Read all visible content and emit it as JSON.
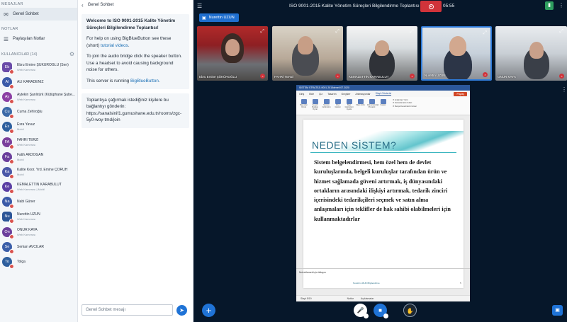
{
  "sidebar": {
    "messages_title": "MESAJLAR",
    "public_chat": "Genel Sohbet",
    "notes_title": "NOTLAR",
    "shared_notes": "Paylaşılan Notlar",
    "users_title": "KULLANICILAR (14)",
    "users": [
      {
        "initials": "Eb",
        "name": "Ebru Emine ŞÜKÜROĞLU (Sen)",
        "sub": "Web Kamerası",
        "color": "#6a4ba8"
      },
      {
        "initials": "Al",
        "name": "ALİ KARADENİZ",
        "sub": "",
        "color": "#3a5aa8"
      },
      {
        "initials": "Ay",
        "name": "Aytekin Şanlıtürk (Kütüphane Şube...",
        "sub": "Web Kamerası",
        "color": "#8b3fa3"
      },
      {
        "initials": "Cu",
        "name": "Cuma Zehiroğlu",
        "sub": "",
        "color": "#3b6aa8"
      },
      {
        "initials": "Es",
        "name": "Esra Yavuz",
        "sub": "Mobil",
        "color": "#2e5f9e"
      },
      {
        "initials": "FA",
        "name": "FAHRİ TERZİ",
        "sub": "Web Kamerası",
        "color": "#7a3f9c"
      },
      {
        "initials": "Fa",
        "name": "Fatih AKDOĞAN",
        "sub": "Mobil",
        "color": "#6b3f9c"
      },
      {
        "initials": "Ka",
        "name": "Kalite Koor. Yrd. Emine ÇORUH",
        "sub": "Mobil",
        "color": "#4a58a8"
      },
      {
        "initials": "Ke",
        "name": "KEMALETTİN KARABULUT",
        "sub": "Web Kamerası | Mobil",
        "color": "#5b3fa3"
      },
      {
        "initials": "Na",
        "name": "Nabi Güner",
        "sub": "",
        "color": "#3a5aa8"
      },
      {
        "initials": "Nu",
        "name": "Nurettin UZUN",
        "sub": "Web Kamerası",
        "color": "#2c5597"
      },
      {
        "initials": "On",
        "name": "ONUR KAYA",
        "sub": "Web Kamerası",
        "color": "#6b3f9c"
      },
      {
        "initials": "Se",
        "name": "Serkan AVCILAR",
        "sub": "",
        "color": "#3b5ea8"
      },
      {
        "initials": "To",
        "name": "Tolga",
        "sub": "",
        "color": "#2e5f9e"
      }
    ]
  },
  "chat": {
    "header": "Genel Sohbet",
    "welcome_prefix": "Welcome to ",
    "welcome_bold": "ISO 9001-2015 Kalite Yönetim Süreçleri Bilgilendirme Toplantısı!",
    "help_prefix": "For help on using BigBlueButton see these (short) ",
    "help_link": "tutorial videos",
    "help_suffix": ".",
    "audio_text": "To join the audio bridge click the speaker button. Use a headset to avoid causing background noise for others.",
    "server_prefix": "This server is running ",
    "server_link": "BigBlueButton",
    "server_suffix": ".",
    "invite_text": "Toplantıya çağırmak istediğiniz kişilere bu bağlantıyı gönderin: https://sanalsinif1.gumushane.edu.tr/rooms/zgc-5y0-woy-tmd/join",
    "input_placeholder": "Genel Sohbet mesajı"
  },
  "main": {
    "title": "ISO 9001-2015 Kalite Yönetim Süreçleri Bilgilendirme Toplantısı",
    "timer": "05:55",
    "presenter": "Nurettin UZUN",
    "videos": [
      {
        "name": "Ebru Emine ŞÜKÜROĞLU"
      },
      {
        "name": "FAHRİ TERZİ"
      },
      {
        "name": "KEMALETTİN KARABULUT"
      },
      {
        "name": "Nurettin UZUN"
      },
      {
        "name": "ONUR KAYA"
      }
    ]
  },
  "presentation": {
    "window_title": "SİSTEM STRATEJİ-9001 2015deneli 07.2020",
    "tabs": [
      "Giriş",
      "Ekle",
      "Çiz",
      "Tasarım",
      "Geçişler",
      "Animasyonlar",
      "Slayt Gösterisi"
    ],
    "share": "Paylaş",
    "ribbon": [
      "Başından Oynat",
      "Geçerli Slayttan Oynat",
      "Sunucu Görünümü",
      "Özel Gösteri",
      "Slayt Gösterisini Ayarla",
      "Slaytı Gizle",
      "Zamanlamaları Prova Et",
      "Kaydet"
    ],
    "checks": [
      "Anlatımları Yürüt",
      "Zamanlamaları Kullan",
      "Medya Denetimlerini Göster"
    ],
    "slide_title": "NEDEN SİSTEM?",
    "slide_body": "Sistem belgelendirmesi, hem özel hem de devlet kuruluşlarında, belgeli kuruluşlar tarafından ürün ve hizmet sağlamada güveni artırmak, iş dünyasındaki ortakların arasındaki ilişkiyi artırmak, tedarik zinciri içerisindeki tedarikçileri seçmek ve satın alma anlaşmaları için teklifler de hak sahibi olabilmeleri için kullanmaktadırlar",
    "slide_footer": "Nurettin UZUN Bilgilendirme",
    "slide_number": "5",
    "notes_placeholder": "Not eklemek için tıklayın",
    "status_slide": "Slayt 5/19",
    "status_notes": "Notlar",
    "status_comments": "Açıklamalar"
  }
}
